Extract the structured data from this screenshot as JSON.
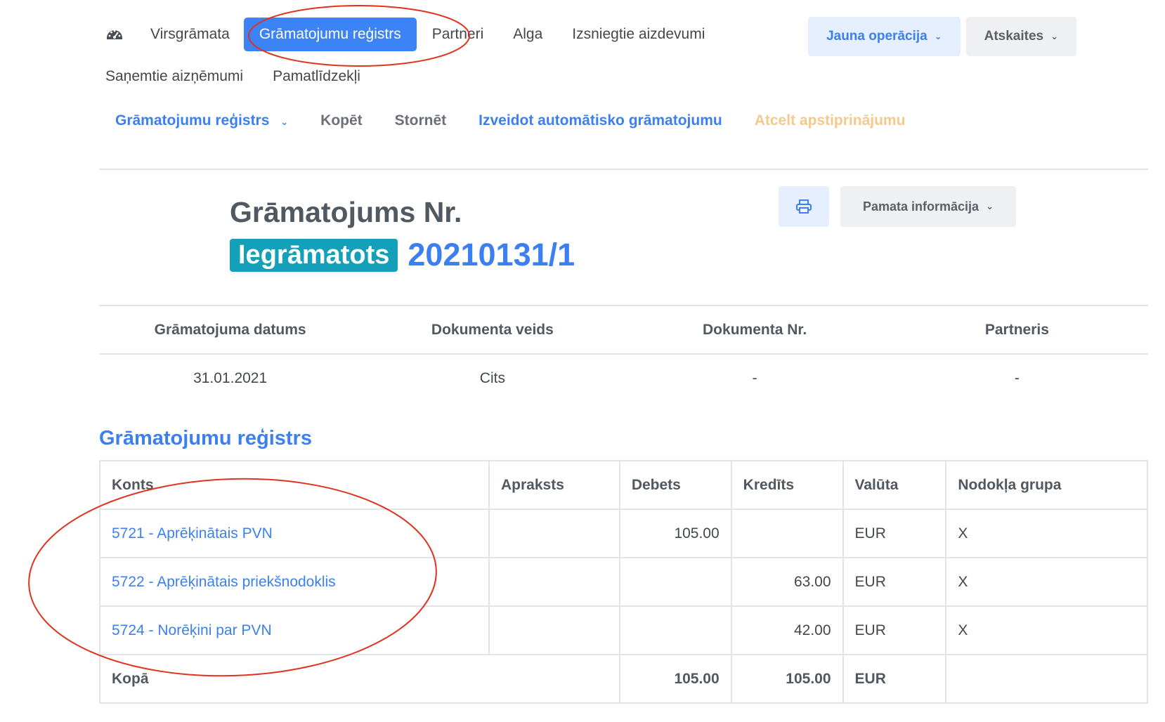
{
  "nav": {
    "items": [
      "Virsgrāmata",
      "Grāmatojumu reģistrs",
      "Partneri",
      "Alga",
      "Izsniegtie aizdevumi"
    ],
    "items_row2": [
      "Saņemtie aizņēmumi",
      "Pamatlīdzekļi"
    ],
    "active_index": 1
  },
  "top_buttons": {
    "new_operation": "Jauna operācija",
    "reports": "Atskaites"
  },
  "sub_nav": {
    "register": "Grāmatojumu reģistrs",
    "copy": "Kopēt",
    "reverse": "Stornēt",
    "auto": "Izveidot automātisko grāmatojumu",
    "cancel_confirm": "Atcelt apstiprinājumu"
  },
  "entry": {
    "title": "Grāmatojums Nr.",
    "status": "Iegrāmatots",
    "number": "20210131/1",
    "basic_info_label": "Pamata informācija"
  },
  "info": {
    "headers": [
      "Grāmatojuma datums",
      "Dokumenta veids",
      "Dokumenta Nr.",
      "Partneris"
    ],
    "values": [
      "31.01.2021",
      "Cits",
      "-",
      "-"
    ]
  },
  "register": {
    "heading": "Grāmatojumu reģistrs",
    "columns": [
      "Konts",
      "Apraksts",
      "Debets",
      "Kredīts",
      "Valūta",
      "Nodokļa grupa"
    ],
    "rows": [
      {
        "account": "5721 - Aprēķinātais PVN",
        "description": "",
        "debit": "105.00",
        "credit": "",
        "currency": "EUR",
        "tax_group": "X"
      },
      {
        "account": "5722 - Aprēķinātais priekšnodoklis",
        "description": "",
        "debit": "",
        "credit": "63.00",
        "currency": "EUR",
        "tax_group": "X"
      },
      {
        "account": "5724 - Norēķini par PVN",
        "description": "",
        "debit": "",
        "credit": "42.00",
        "currency": "EUR",
        "tax_group": "X"
      }
    ],
    "total": {
      "label": "Kopā",
      "debit": "105.00",
      "credit": "105.00",
      "currency": "EUR"
    }
  },
  "colors": {
    "primary": "#3c83f6",
    "badge": "#14a0b8",
    "annotation": "#e0321e"
  }
}
